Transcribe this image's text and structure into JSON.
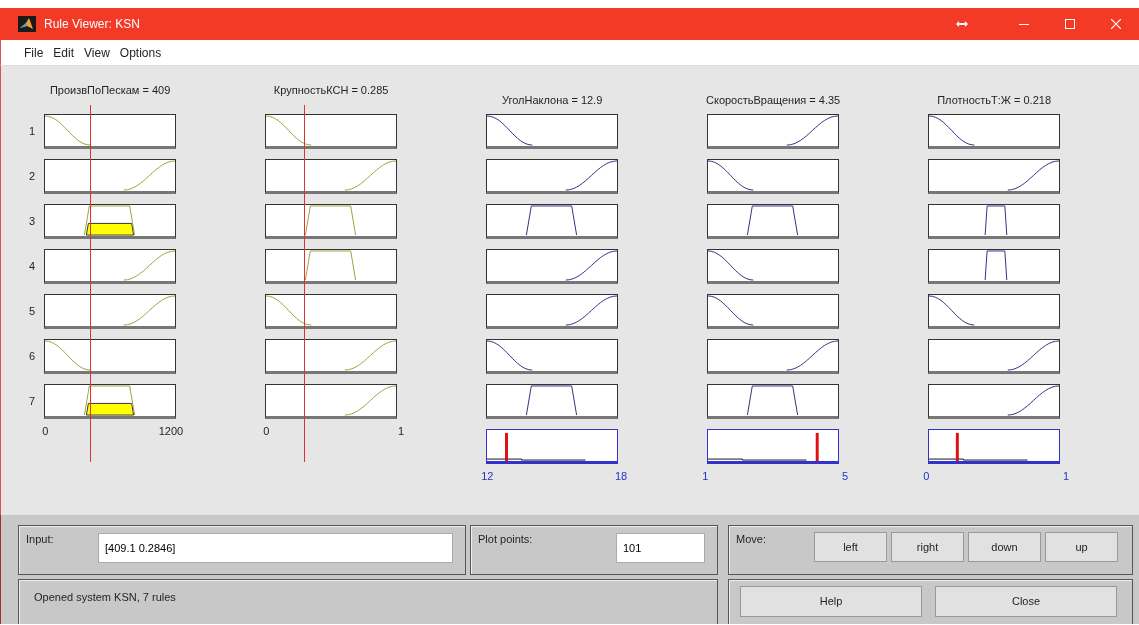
{
  "window": {
    "title": "Rule Viewer: KSN"
  },
  "menu": [
    "File",
    "Edit",
    "View",
    "Options"
  ],
  "rule_numbers": [
    "1",
    "2",
    "3",
    "4",
    "5",
    "6",
    "7"
  ],
  "inputs": [
    {
      "label": "ПроизвПоПескам = 409",
      "level": 0.34,
      "axis_min": "0",
      "axis_max": "1200",
      "rules": [
        {
          "kind": "falling",
          "fired": false
        },
        {
          "kind": "rising",
          "fired": false
        },
        {
          "kind": "plateau",
          "fired": true
        },
        {
          "kind": "rising",
          "fired": false
        },
        {
          "kind": "rising",
          "fired": false
        },
        {
          "kind": "falling",
          "fired": false
        },
        {
          "kind": "plateau",
          "fired": true
        }
      ]
    },
    {
      "label": "КрупностьКСН = 0.285",
      "level": 0.285,
      "axis_min": "0",
      "axis_max": "1",
      "rules": [
        {
          "kind": "falling",
          "fired": false
        },
        {
          "kind": "rising",
          "fired": false
        },
        {
          "kind": "plateau",
          "fired": false
        },
        {
          "kind": "plateau",
          "fired": false
        },
        {
          "kind": "falling",
          "fired": false
        },
        {
          "kind": "rising",
          "fired": false
        },
        {
          "kind": "rising",
          "fired": false
        }
      ]
    }
  ],
  "outputs": [
    {
      "label": "УголНаклона = 12.9",
      "level": 0.15,
      "axis_min": "12",
      "axis_max": "18",
      "rules": [
        {
          "kind": "falling"
        },
        {
          "kind": "rising"
        },
        {
          "kind": "plateau"
        },
        {
          "kind": "rising"
        },
        {
          "kind": "rising"
        },
        {
          "kind": "falling"
        },
        {
          "kind": "plateau"
        }
      ]
    },
    {
      "label": "СкоростьВращения = 4.35",
      "level": 0.84,
      "axis_min": "1",
      "axis_max": "5",
      "rules": [
        {
          "kind": "rising"
        },
        {
          "kind": "falling"
        },
        {
          "kind": "plateau"
        },
        {
          "kind": "falling"
        },
        {
          "kind": "falling"
        },
        {
          "kind": "rising"
        },
        {
          "kind": "plateau"
        }
      ]
    },
    {
      "label": "ПлотностьТ:Ж = 0.218",
      "level": 0.218,
      "axis_min": "0",
      "axis_max": "1",
      "rules": [
        {
          "kind": "falling"
        },
        {
          "kind": "rising"
        },
        {
          "kind": "narrow"
        },
        {
          "kind": "narrow"
        },
        {
          "kind": "falling"
        },
        {
          "kind": "rising"
        },
        {
          "kind": "rising"
        }
      ]
    }
  ],
  "input": {
    "label": "Input:",
    "value": "[409.1 0.2846]"
  },
  "plot_points": {
    "label": "Plot points:",
    "value": "101"
  },
  "move": {
    "label": "Move:",
    "buttons": [
      "left",
      "right",
      "down",
      "up"
    ]
  },
  "status": "Opened system KSN, 7 rules",
  "buttons": [
    "Help",
    "Close"
  ]
}
